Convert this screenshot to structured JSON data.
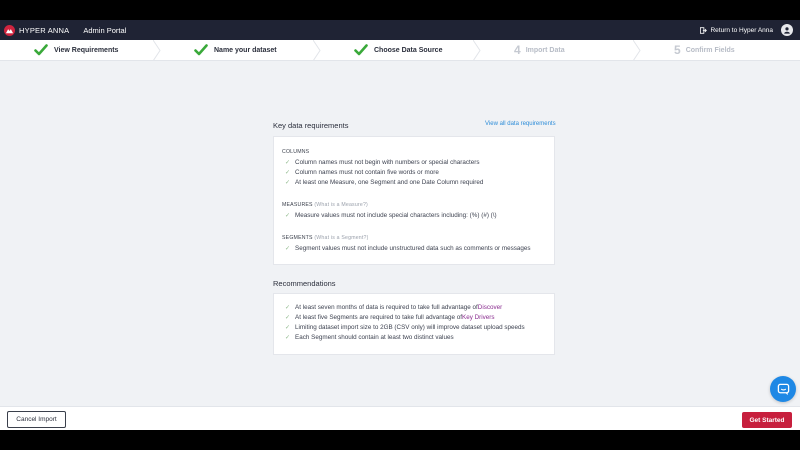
{
  "app": {
    "brand": "HYPER ANNA",
    "portal": "Admin Portal",
    "return_label": "Return to Hyper Anna"
  },
  "steps": [
    {
      "label": "View Requirements",
      "status": "done"
    },
    {
      "label": "Name your dataset",
      "status": "done"
    },
    {
      "label": "Choose Data Source",
      "status": "done"
    },
    {
      "number": "4",
      "label": "Import Data",
      "status": "pending"
    },
    {
      "number": "5",
      "label": "Confirm Fields",
      "status": "pending"
    }
  ],
  "requirements": {
    "title": "Key data requirements",
    "view_all": "View all data requirements",
    "columns": {
      "heading": "COLUMNS",
      "items": [
        "Column names must not begin with numbers or special characters",
        "Column names must not contain five words or more",
        "At least one Measure, one Segment and one Date Column required"
      ]
    },
    "measures": {
      "heading": "MEASURES",
      "sub": "(What is a Measure?)",
      "items": [
        "Measure values must not include special characters including: (%) (#) (\\)"
      ]
    },
    "segments": {
      "heading": "SEGMENTS",
      "sub": "(What is a Segment?)",
      "items": [
        "Segment values must not include unstructured data such as comments or messages"
      ]
    }
  },
  "recommendations": {
    "title": "Recommendations",
    "item1_prefix": "At least seven months of data is required to take full advantage of ",
    "item1_link": "Discover",
    "item2_prefix": "At least five Segments are required to take full advantage of ",
    "item2_link": "Key Drivers",
    "item3": "Limiting dataset import size to 2GB (CSV only) will improve dataset upload speeds",
    "item4": "Each Segment should contain at least two distinct values"
  },
  "footer": {
    "cancel_label": "Cancel Import",
    "start_label": "Get Started"
  },
  "colors": {
    "accent": "#c71f3d",
    "link": "#2c8cd8",
    "check": "#3aa93a",
    "nav_bg": "#1f2334"
  }
}
